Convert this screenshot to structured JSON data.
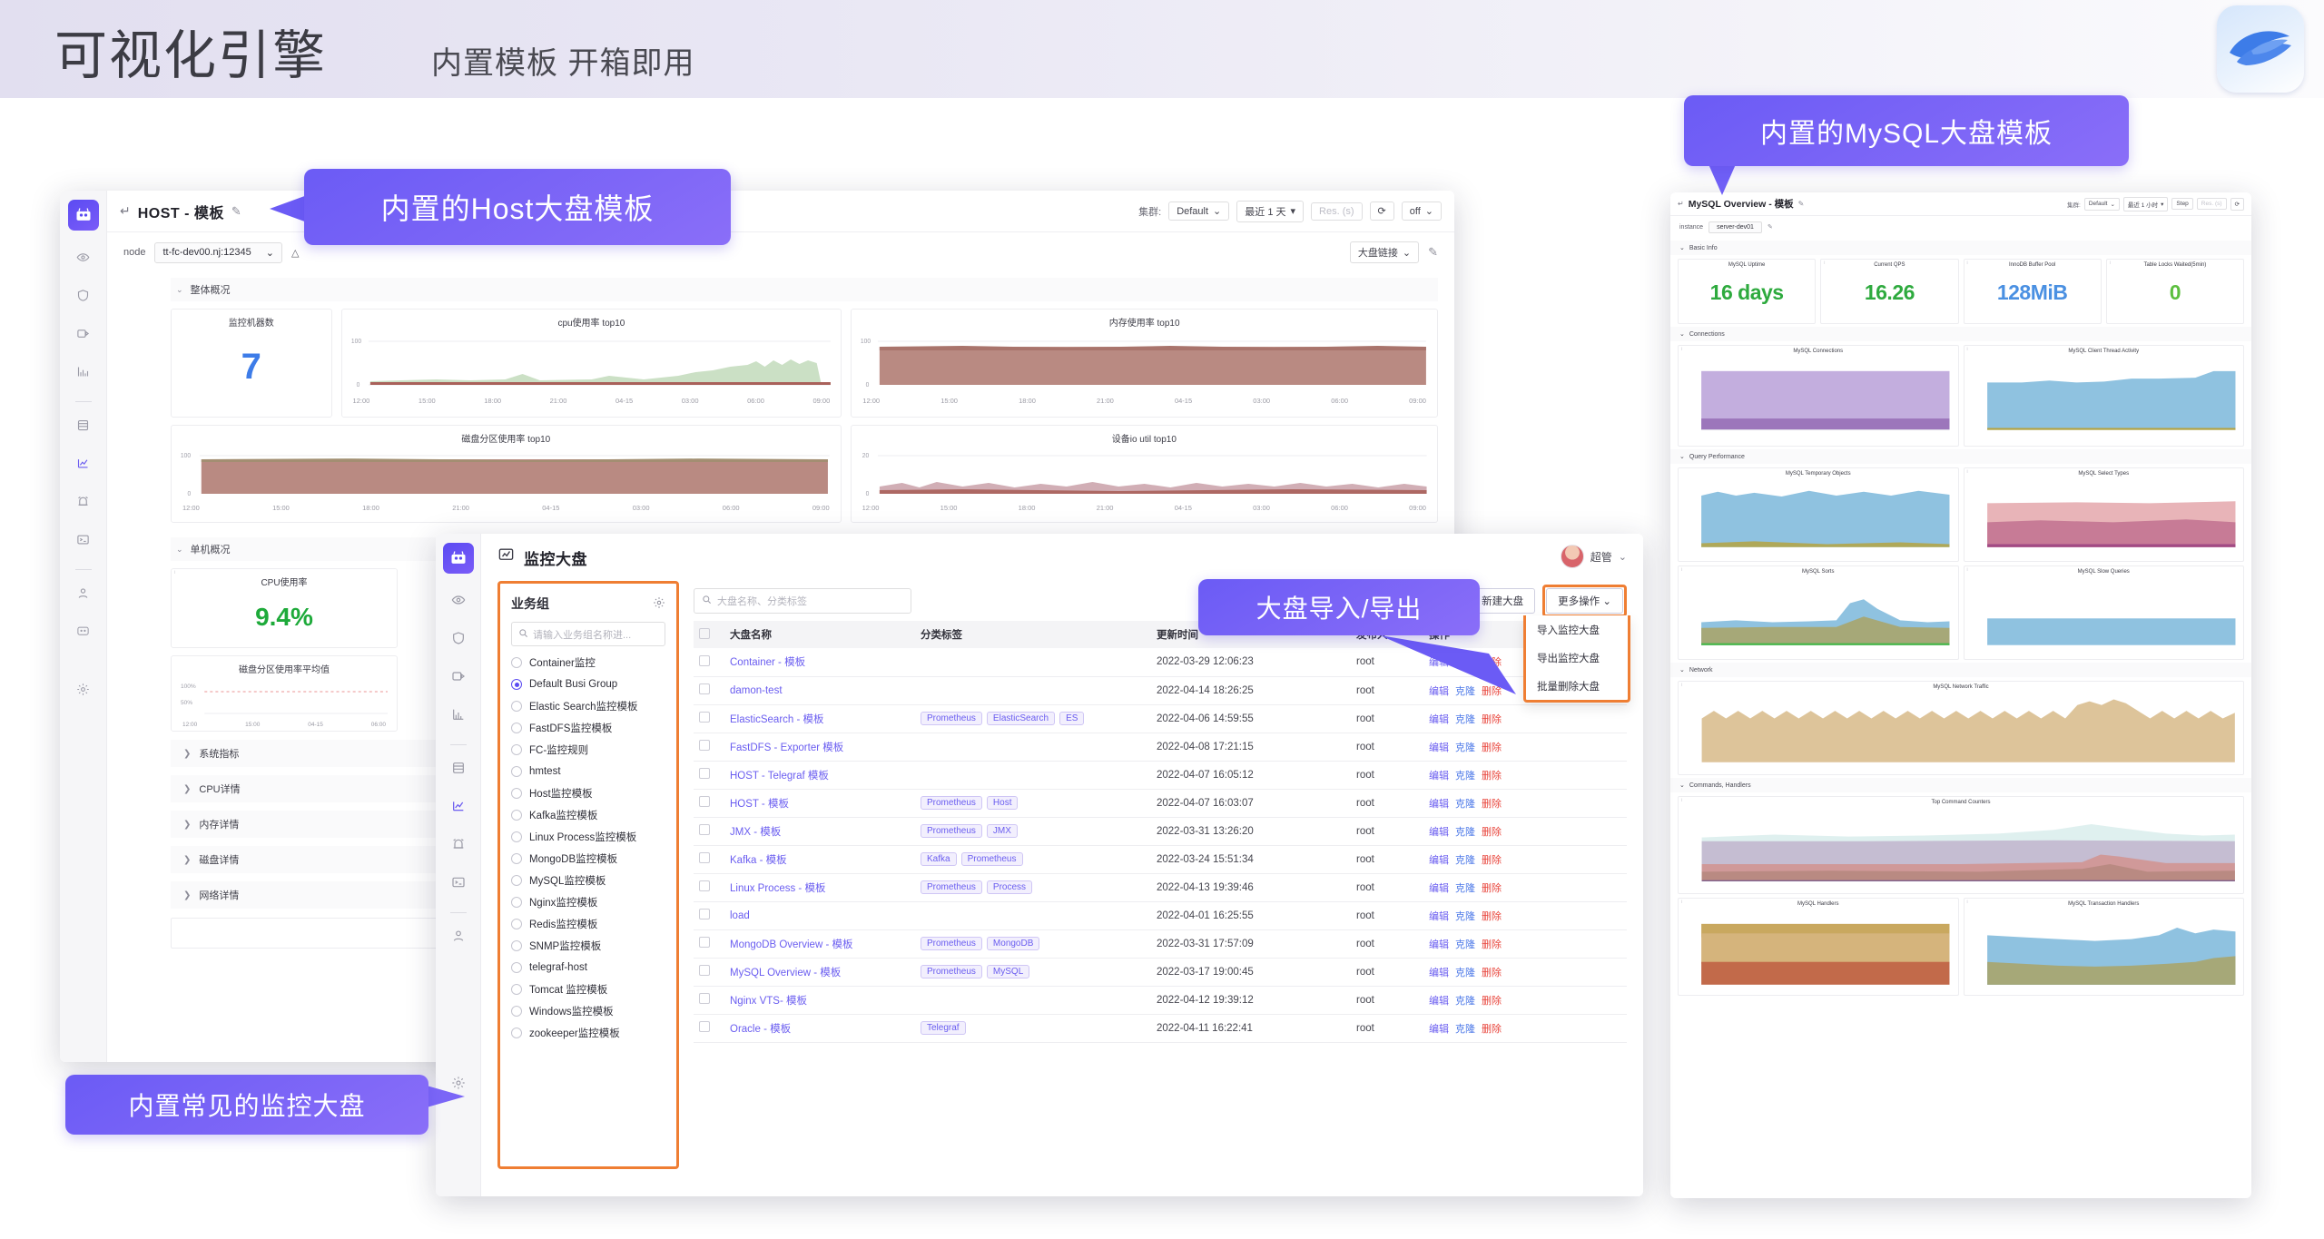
{
  "header": {
    "title": "可视化引擎",
    "subtitle": "内置模板 开箱即用",
    "logo_alt": "flashcat-logo"
  },
  "callouts": {
    "host": "内置的Host大盘模板",
    "mysql": "内置的MySQL大盘模板",
    "common": "内置常见的监控大盘",
    "import_export": "大盘导入/导出"
  },
  "host_window": {
    "title": "HOST - 模板",
    "back_icon": "back-arrow-icon",
    "edit_icon": "pencil-icon",
    "toolbar": {
      "cluster_label": "集群:",
      "cluster_value": "Default",
      "time_range": "最近 1 天",
      "resolution_placeholder": "Res. (s)",
      "refresh_icon": "refresh-icon",
      "auto_refresh": "off"
    },
    "filter": {
      "node_label": "node",
      "node_value": "tt-fc-dev00.nj:12345",
      "link_label": "大盘链接",
      "edit_icon": "pencil-icon"
    },
    "sections": [
      {
        "name": "整体概况",
        "expanded": true
      },
      {
        "name": "单机概况",
        "expanded": true
      },
      {
        "name": "系统指标",
        "expanded": false
      },
      {
        "name": "CPU详情",
        "expanded": false
      },
      {
        "name": "内存详情",
        "expanded": false
      },
      {
        "name": "磁盘详情",
        "expanded": false
      },
      {
        "name": "网络详情",
        "expanded": false
      }
    ],
    "panels": {
      "host_count_title": "监控机器数",
      "host_count_value": "7",
      "cpu_top10_title": "cpu使用率 top10",
      "mem_top10_title": "内存使用率 top10",
      "disk_top10_title": "磁盘分区使用率 top10",
      "diskio_title": "设备io util top10",
      "cpu_usage_title": "CPU使用率",
      "cpu_usage_value": "9.4%",
      "disk_avg_title": "磁盘分区使用率平均值"
    },
    "axis_ticks": [
      "12:00",
      "15:00",
      "18:00",
      "21:00",
      "04-15",
      "03:00",
      "06:00",
      "09:00"
    ],
    "y_ticks_100": [
      "100",
      "0"
    ],
    "y_ticks_20": [
      "20",
      "0"
    ],
    "y_ticks_pct": [
      "100%",
      "50%"
    ]
  },
  "mysql_window": {
    "title": "MySQL Overview - 模板",
    "back_icon": "back-arrow-icon",
    "edit_icon": "pencil-icon",
    "toolbar": {
      "cluster_label": "集群:",
      "cluster_value": "Default",
      "time_range": "最近 1 小时",
      "step_label": "Step",
      "resolution_placeholder": "Res. (s)",
      "refresh_icon": "refresh-icon"
    },
    "instance_label": "instance",
    "instance_value": "server-dev01",
    "sections": [
      "Basic Info",
      "Connections",
      "Query Performance",
      "Network",
      "Commands, Handlers"
    ],
    "stats": [
      {
        "title": "MySQL Uptime",
        "value": "16 days",
        "color": "#2eaa3e"
      },
      {
        "title": "Current QPS",
        "value": "16.26",
        "color": "#2eaa3e"
      },
      {
        "title": "InnoDB Buffer Pool",
        "value": "128MiB",
        "color": "#4a90e2"
      },
      {
        "title": "Table Locks Waited(5min)",
        "value": "0",
        "color": "#5cbf3f"
      }
    ],
    "charts": [
      "MySQL Connections",
      "MySQL Client Thread Activity",
      "MySQL Temporary Objects",
      "MySQL Select Types",
      "MySQL Sorts",
      "MySQL Slow Queries",
      "MySQL Network Traffic",
      "Top Command Counters",
      "MySQL Handlers",
      "MySQL Transaction Handlers"
    ]
  },
  "dashboard_window": {
    "page_icon": "dashboard-icon",
    "page_title": "监控大盘",
    "user_name": "超管",
    "user_caret": "chevron-down-icon",
    "biz_group": {
      "title": "业务组",
      "gear_icon": "gear-icon",
      "search_placeholder": "请输入业务组名称进...",
      "selected": "Default Busi Group",
      "items": [
        "Container监控",
        "Default Busi Group",
        "Elastic Search监控模板",
        "FastDFS监控模板",
        "FC-监控规则",
        "hmtest",
        "Host监控模板",
        "Kafka监控模板",
        "Linux Process监控模板",
        "MongoDB监控模板",
        "MySQL监控模板",
        "Nginx监控模板",
        "Redis监控模板",
        "SNMP监控模板",
        "telegraf-host",
        "Tomcat 监控模板",
        "Windows监控模板",
        "zookeeper监控模板"
      ]
    },
    "search_placeholder": "大盘名称、分类标签",
    "buttons": {
      "new_dashboard": "新建大盘",
      "more_actions": "更多操作"
    },
    "more_menu": [
      "导入监控大盘",
      "导出监控大盘",
      "批量删除大盘"
    ],
    "table": {
      "columns": [
        "大盘名称",
        "分类标签",
        "更新时间",
        "发布人",
        "操作"
      ],
      "op_labels": {
        "edit": "编辑",
        "clone": "克隆",
        "delete": "删除"
      },
      "rows": [
        {
          "name": "Container - 模板",
          "tags": [],
          "updated": "2022-03-29 12:06:23",
          "publisher": "root"
        },
        {
          "name": "damon-test",
          "tags": [],
          "updated": "2022-04-14 18:26:25",
          "publisher": "root"
        },
        {
          "name": "ElasticSearch - 模板",
          "tags": [
            "Prometheus",
            "ElasticSearch",
            "ES"
          ],
          "updated": "2022-04-06 14:59:55",
          "publisher": "root"
        },
        {
          "name": "FastDFS - Exporter 模板",
          "tags": [],
          "updated": "2022-04-08 17:21:15",
          "publisher": "root"
        },
        {
          "name": "HOST - Telegraf 模板",
          "tags": [],
          "updated": "2022-04-07 16:05:12",
          "publisher": "root"
        },
        {
          "name": "HOST - 模板",
          "tags": [
            "Prometheus",
            "Host"
          ],
          "updated": "2022-04-07 16:03:07",
          "publisher": "root"
        },
        {
          "name": "JMX - 模板",
          "tags": [
            "Prometheus",
            "JMX"
          ],
          "updated": "2022-03-31 13:26:20",
          "publisher": "root"
        },
        {
          "name": "Kafka - 模板",
          "tags": [
            "Kafka",
            "Prometheus"
          ],
          "updated": "2022-03-24 15:51:34",
          "publisher": "root"
        },
        {
          "name": "Linux Process - 模板",
          "tags": [
            "Prometheus",
            "Process"
          ],
          "updated": "2022-04-13 19:39:46",
          "publisher": "root"
        },
        {
          "name": "load",
          "tags": [],
          "updated": "2022-04-01 16:25:55",
          "publisher": "root"
        },
        {
          "name": "MongoDB Overview - 模板",
          "tags": [
            "Prometheus",
            "MongoDB"
          ],
          "updated": "2022-03-31 17:57:09",
          "publisher": "root"
        },
        {
          "name": "MySQL Overview - 模板",
          "tags": [
            "Prometheus",
            "MySQL"
          ],
          "updated": "2022-03-17 19:00:45",
          "publisher": "root"
        },
        {
          "name": "Nginx VTS- 模板",
          "tags": [],
          "updated": "2022-04-12 19:39:12",
          "publisher": "root"
        },
        {
          "name": "Oracle - 模板",
          "tags": [
            "Telegraf"
          ],
          "updated": "2022-04-11 16:22:41",
          "publisher": "root"
        }
      ]
    },
    "sidebar_icons": [
      "logo-icon",
      "eye-icon",
      "shield-icon",
      "play-box-icon",
      "bar-chart-icon",
      "database-icon",
      "line-chart-icon",
      "alarm-icon",
      "terminal-icon",
      "user-icon",
      "gear-icon"
    ]
  },
  "colors": {
    "accent_purple": "#6a5df0",
    "highlight_orange": "#ef7e33",
    "callout_purple": "#7060f6",
    "delete_red": "#e8453c",
    "green": "#2eaa3e",
    "blue": "#4a90e2"
  }
}
